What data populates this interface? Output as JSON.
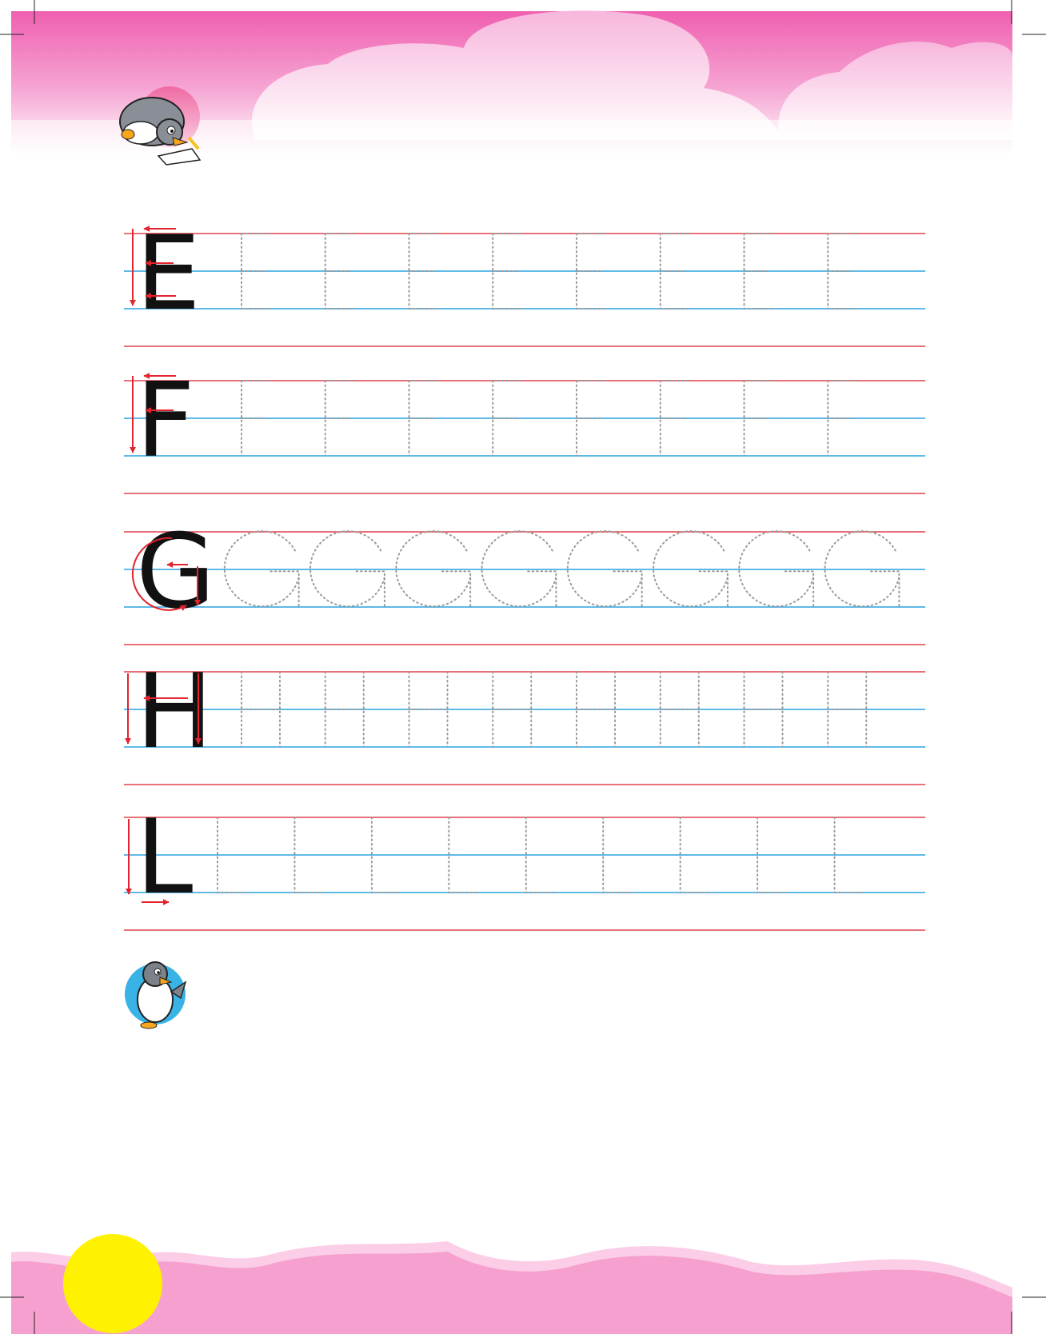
{
  "worksheet": {
    "colors": {
      "header_pink": "#f06bb7",
      "cloud_pink": "#f9c8e3",
      "footer_pink": "#f6a3d0",
      "sun_yellow": "#fff200",
      "guide_red": "#e0404c",
      "guide_blue": "#2aa3e0",
      "trace_gray": "#9a9a9a",
      "arrow_red": "#e3232e",
      "letter_black": "#111111"
    },
    "rows": [
      {
        "letter": "E",
        "trace_count": 8
      },
      {
        "letter": "F",
        "trace_count": 8
      },
      {
        "letter": "G",
        "trace_count": 8
      },
      {
        "letter": "H",
        "trace_count": 8
      },
      {
        "letter": "L",
        "trace_count": 9
      }
    ],
    "mascots": [
      "penguin-writing-icon",
      "penguin-waving-icon"
    ],
    "decor": [
      "sun-icon",
      "cloud-icon"
    ]
  }
}
